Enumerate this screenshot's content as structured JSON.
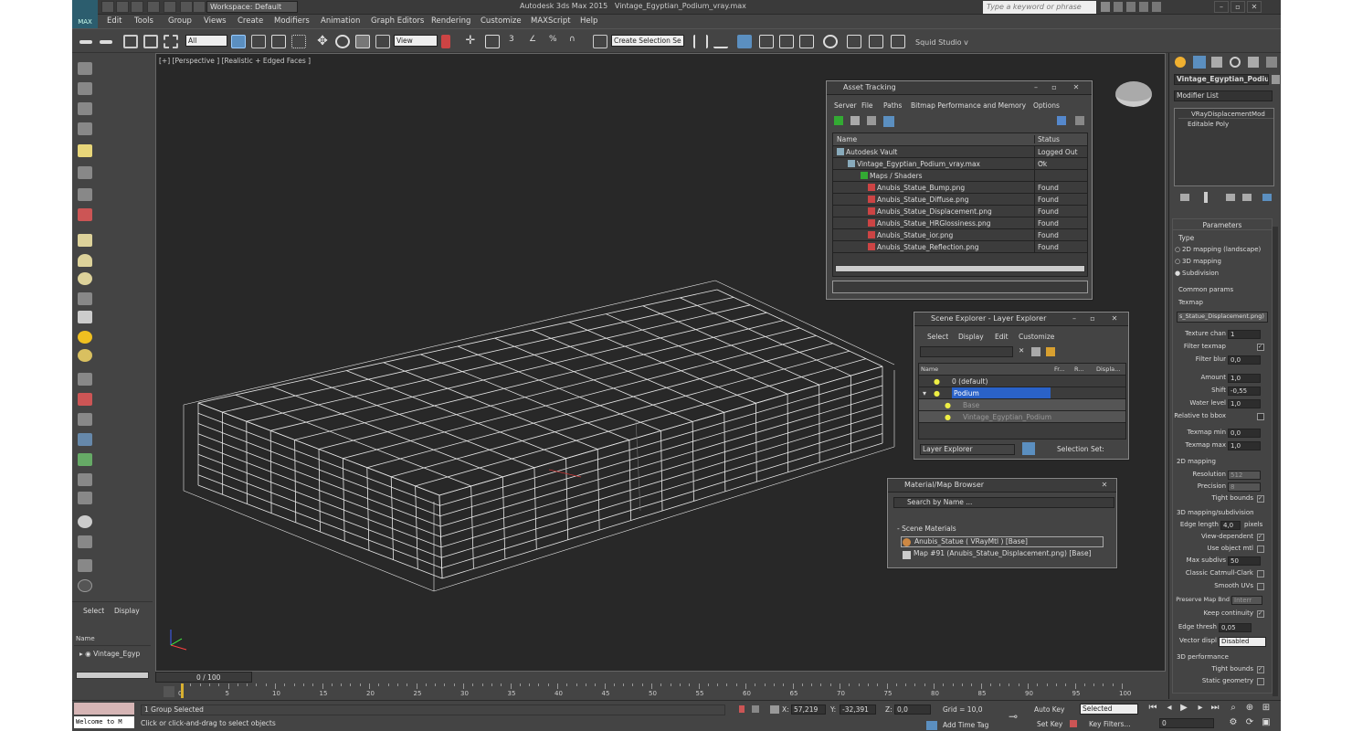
{
  "app": {
    "title": "Autodesk 3ds Max 2015",
    "file": "Vintage_Egyptian_Podium_vray.max",
    "logo": "MAX",
    "workspace": "Workspace: Default",
    "help_placeholder": "Type a keyword or phrase"
  },
  "menu": [
    "Edit",
    "Tools",
    "Group",
    "Views",
    "Create",
    "Modifiers",
    "Animation",
    "Graph Editors",
    "Rendering",
    "Customize",
    "MAXScript",
    "Help"
  ],
  "toolbar": {
    "filter": "All",
    "refcoord": "View",
    "selset": "Create Selection Se",
    "studio": "Squid Studio v"
  },
  "viewport": {
    "label": "[+] [Perspective ] [Realistic + Edged Faces ]"
  },
  "asset_tracking": {
    "title": "Asset Tracking",
    "menus": [
      "Server",
      "File",
      "Paths",
      "Bitmap Performance and Memory",
      "Options"
    ],
    "col_name": "Name",
    "col_status": "Status",
    "rows": [
      {
        "name": "Autodesk Vault",
        "status": "Logged Out ..."
      },
      {
        "name": "Vintage_Egyptian_Podium_vray.max",
        "status": "Ok"
      },
      {
        "name": "Maps / Shaders",
        "status": ""
      },
      {
        "name": "Anubis_Statue_Bump.png",
        "status": "Found"
      },
      {
        "name": "Anubis_Statue_Diffuse.png",
        "status": "Found"
      },
      {
        "name": "Anubis_Statue_Displacement.png",
        "status": "Found"
      },
      {
        "name": "Anubis_Statue_HRGlossiness.png",
        "status": "Found"
      },
      {
        "name": "Anubis_Statue_ior.png",
        "status": "Found"
      },
      {
        "name": "Anubis_Statue_Reflection.png",
        "status": "Found"
      }
    ]
  },
  "scene_explorer": {
    "title": "Scene Explorer - Layer Explorer",
    "menus": [
      "Select",
      "Display",
      "Edit",
      "Customize"
    ],
    "cols": [
      "Name",
      "Fr...",
      "R...",
      "Displa..."
    ],
    "rows": [
      {
        "name": "0 (default)"
      },
      {
        "name": "Podium"
      },
      {
        "name": "Base"
      },
      {
        "name": "Vintage_Egyptian_Podium"
      }
    ],
    "footer_left": "Layer Explorer",
    "footer_right": "Selection Set:"
  },
  "mat_browser": {
    "title": "Material/Map Browser",
    "search": "Search by Name ...",
    "section": "- Scene Materials",
    "items": [
      "Anubis_Statue  ( VRayMtl )  [Base]",
      "Map #91 (Anubis_Statue_Displacement.png)  [Base]"
    ]
  },
  "left_panel": {
    "tabs": [
      "Select",
      "Display"
    ],
    "col": "Name",
    "item": "Vintage_Egyp"
  },
  "cmd": {
    "object": "Vintage_Egyptian_Podiur",
    "modlist": "Modifier List",
    "stack": [
      "VRayDisplacementMod",
      "Editable Poly"
    ],
    "rollout": "Parameters",
    "type_label": "Type",
    "types": [
      "2D mapping (landscape)",
      "3D mapping",
      "Subdivision"
    ],
    "common": "Common params",
    "texmap": "Texmap",
    "texmap_val": "s_Statue_Displacement.png)",
    "params": [
      {
        "l": "Texture chan",
        "v": "1"
      },
      {
        "l": "Filter texmap",
        "c": true
      },
      {
        "l": "Filter blur",
        "v": "0,0"
      },
      {
        "l": "Amount",
        "v": "1,0"
      },
      {
        "l": "Shift",
        "v": "-0,55"
      },
      {
        "l": "Water level",
        "v": "1,0"
      },
      {
        "l": "Relative to bbox",
        "c": false
      },
      {
        "l": "Texmap min",
        "v": "0,0"
      },
      {
        "l": "Texmap max",
        "v": "1,0"
      }
    ],
    "sec2d": "2D mapping",
    "res": {
      "l": "Resolution",
      "v": "512"
    },
    "prec": {
      "l": "Precision",
      "v": "8"
    },
    "tight": "Tight bounds",
    "sec3d": "3D mapping/subdivision",
    "edge": {
      "l": "Edge length",
      "v": "4,0",
      "u": "pixels"
    },
    "checks3d": [
      {
        "l": "View-dependent",
        "c": true
      },
      {
        "l": "Use object mtl",
        "c": false
      }
    ],
    "maxsub": {
      "l": "Max subdivs",
      "v": "50"
    },
    "checks3d2": [
      {
        "l": "Classic Catmull-Clark",
        "c": false
      },
      {
        "l": "Smooth UVs",
        "c": false
      }
    ],
    "pmb": {
      "l": "Preserve Map Bnd",
      "v": "Interr"
    },
    "keep": {
      "l": "Keep continuity",
      "c": true
    },
    "edgethresh": {
      "l": "Edge thresh",
      "v": "0,05"
    },
    "vecdisp": {
      "l": "Vector displ",
      "v": "Disabled"
    },
    "perf": "3D performance",
    "perfchecks": [
      {
        "l": "Tight bounds",
        "c": true
      },
      {
        "l": "Static geometry",
        "c": false
      }
    ]
  },
  "timeline": {
    "frame": "0 / 100",
    "ticks": [
      "0",
      "5",
      "10",
      "15",
      "20",
      "25",
      "30",
      "35",
      "40",
      "45",
      "50",
      "55",
      "60",
      "65",
      "70",
      "75",
      "80",
      "85",
      "90",
      "95",
      "100"
    ]
  },
  "status": {
    "maxscript": "Welcome to M",
    "selected": "1 Group Selected",
    "prompt": "Click or click-and-drag to select objects",
    "x": "57,219",
    "y": "-32,391",
    "z": "0,0",
    "grid": "Grid = 10,0",
    "autokey": "Auto Key",
    "setkey": "Set Key",
    "keymode": "Selected",
    "keyfilters": "Key Filters...",
    "frame": "0",
    "addtimetag": "Add Time Tag",
    "xlbl": "X:",
    "ylbl": "Y:",
    "zlbl": "Z:"
  }
}
